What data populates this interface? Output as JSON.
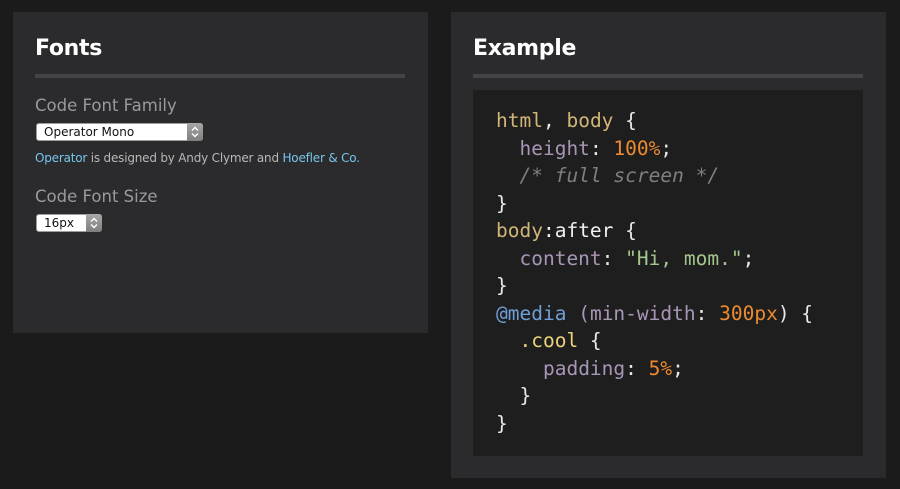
{
  "fonts_panel": {
    "title": "Fonts",
    "font_family": {
      "label": "Code Font Family",
      "selected": "Operator Mono"
    },
    "credit": {
      "link1": "Operator",
      "middle": " is designed by Andy Clymer and ",
      "link2": "Hoefler & Co.",
      "end": ""
    },
    "font_size": {
      "label": "Code Font Size",
      "selected": "16px"
    }
  },
  "example_panel": {
    "title": "Example",
    "code": {
      "line1": {
        "sel1": "html",
        "comma": ",",
        "sel2": " body",
        "brace": " {"
      },
      "line2": {
        "indent": "  ",
        "prop": "height",
        "colon": ": ",
        "value": "100%",
        "semi": ";"
      },
      "line3": {
        "indent": "  ",
        "comment": "/* full screen */"
      },
      "line4": {
        "brace": "}"
      },
      "line5": {
        "sel": "body",
        "pseudo": ":after",
        "brace": " {"
      },
      "line6": {
        "indent": "  ",
        "prop": "content",
        "colon": ": ",
        "value": "\"Hi, mom.\"",
        "semi": ";"
      },
      "line7": {
        "brace": "}"
      },
      "line8": {
        "at": "@media",
        "space": " ",
        "open": "(",
        "prop": "min-width",
        "colon": ": ",
        "value": "300px",
        "close": ")",
        "brace": " {"
      },
      "line9": {
        "indent": "  ",
        "sel": ".cool",
        "brace": " {"
      },
      "line10": {
        "indent": "    ",
        "prop": "padding",
        "colon": ": ",
        "value": "5%",
        "semi": ";"
      },
      "line11": {
        "indent": "  ",
        "brace": "}"
      },
      "line12": {
        "brace": "}"
      }
    }
  },
  "colors": {
    "background": "#1b1b1c",
    "panel": "#2b2b2d",
    "link": "#77c6ea",
    "code_selector": "#d2b678",
    "code_property": "#a996b6",
    "code_number": "#ec8b2f",
    "code_string": "#a5c58e",
    "code_at_rule": "#6f9fd6",
    "code_class": "#ecd27a",
    "code_comment": "#7f7f7f"
  }
}
